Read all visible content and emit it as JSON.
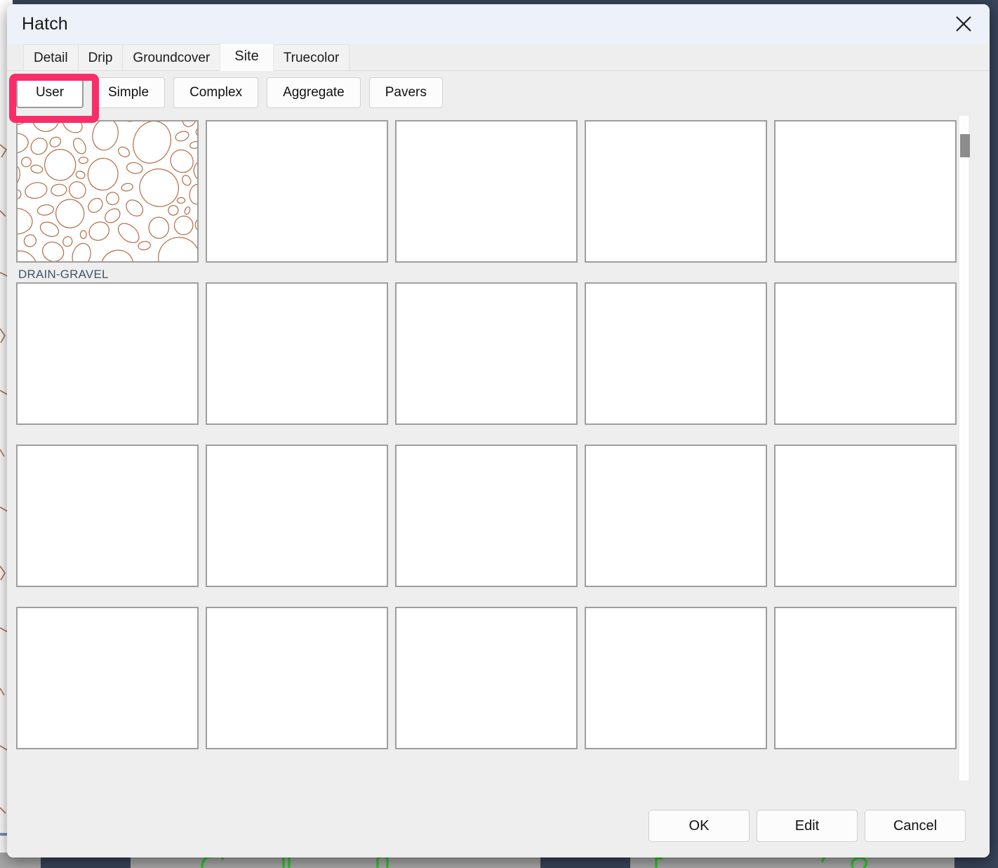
{
  "window": {
    "title": "Hatch",
    "close_icon": "close-icon"
  },
  "tabs": [
    {
      "label": "Detail",
      "selected": false
    },
    {
      "label": "Drip",
      "selected": false
    },
    {
      "label": "Groundcover",
      "selected": false
    },
    {
      "label": "Site",
      "selected": true
    },
    {
      "label": "Truecolor",
      "selected": false
    }
  ],
  "subtabs": [
    {
      "label": "User",
      "active": true,
      "highlighted": true
    },
    {
      "label": "Simple",
      "active": false,
      "highlighted": false
    },
    {
      "label": "Complex",
      "active": false,
      "highlighted": false
    },
    {
      "label": "Aggregate",
      "active": false,
      "highlighted": false
    },
    {
      "label": "Pavers",
      "active": false,
      "highlighted": false
    }
  ],
  "patterns": [
    {
      "label": "DRAIN-GRAVEL",
      "thumbnail": "gravel-pattern",
      "filled": true
    },
    {
      "label": "",
      "thumbnail": "",
      "filled": false
    },
    {
      "label": "",
      "thumbnail": "",
      "filled": false
    },
    {
      "label": "",
      "thumbnail": "",
      "filled": false
    },
    {
      "label": "",
      "thumbnail": "",
      "filled": false
    },
    {
      "label": "",
      "thumbnail": "",
      "filled": false
    },
    {
      "label": "",
      "thumbnail": "",
      "filled": false
    },
    {
      "label": "",
      "thumbnail": "",
      "filled": false
    },
    {
      "label": "",
      "thumbnail": "",
      "filled": false
    },
    {
      "label": "",
      "thumbnail": "",
      "filled": false
    },
    {
      "label": "",
      "thumbnail": "",
      "filled": false
    },
    {
      "label": "",
      "thumbnail": "",
      "filled": false
    },
    {
      "label": "",
      "thumbnail": "",
      "filled": false
    },
    {
      "label": "",
      "thumbnail": "",
      "filled": false
    },
    {
      "label": "",
      "thumbnail": "",
      "filled": false
    },
    {
      "label": "",
      "thumbnail": "",
      "filled": false
    },
    {
      "label": "",
      "thumbnail": "",
      "filled": false
    },
    {
      "label": "",
      "thumbnail": "",
      "filled": false
    },
    {
      "label": "",
      "thumbnail": "",
      "filled": false
    },
    {
      "label": "",
      "thumbnail": "",
      "filled": false
    }
  ],
  "scrollbar": {
    "name": "pattern-grid-scrollbar",
    "thumb_name": "scrollbar-thumb"
  },
  "footer_buttons": [
    {
      "label": "OK"
    },
    {
      "label": "Edit"
    },
    {
      "label": "Cancel"
    }
  ],
  "colors": {
    "highlight_pink": "#fa2d68",
    "titlebar": "#edf1fa",
    "dialog_bg": "#eeeeee",
    "cell_border": "#9e9e9e",
    "pattern_stroke": "#b5714c",
    "label_text": "#41536a",
    "cad_green": "#2ec42e"
  }
}
